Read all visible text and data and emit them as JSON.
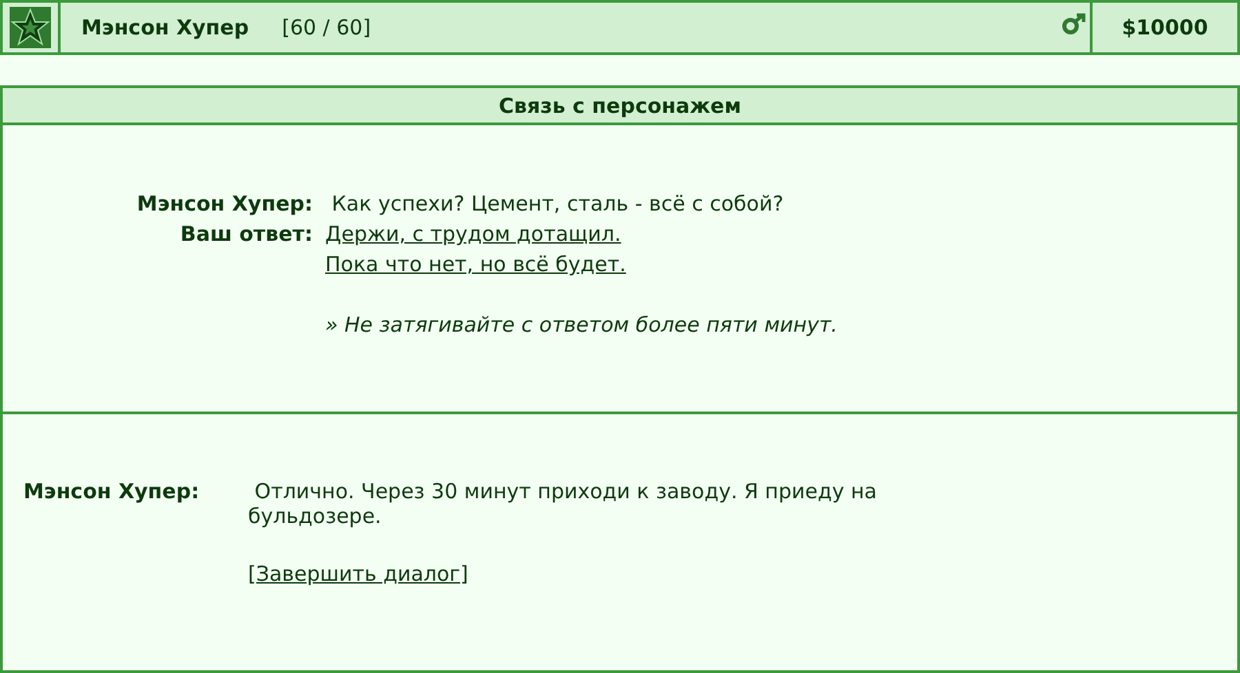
{
  "header": {
    "name": "Мэнсон Хупер",
    "hp": "[60 / 60]",
    "money": "$10000"
  },
  "panel": {
    "title": "Связь с персонажем",
    "question": {
      "speaker": "Мэнсон Хупер:",
      "text": "Как успехи? Цемент, сталь - всё с собой?"
    },
    "answer_label": "Ваш ответ:",
    "answers": [
      "Держи, с трудом дотащил.",
      "Пока что нет, но всё будет."
    ],
    "note": "» Не затягивайте с ответом более пяти минут.",
    "reply": {
      "speaker": "Мэнсон Хупер:",
      "text": "Отлично. Через 30 минут приходи к заводу. Я приеду на бульдозере."
    },
    "end_link": "[Завершить диалог]"
  }
}
